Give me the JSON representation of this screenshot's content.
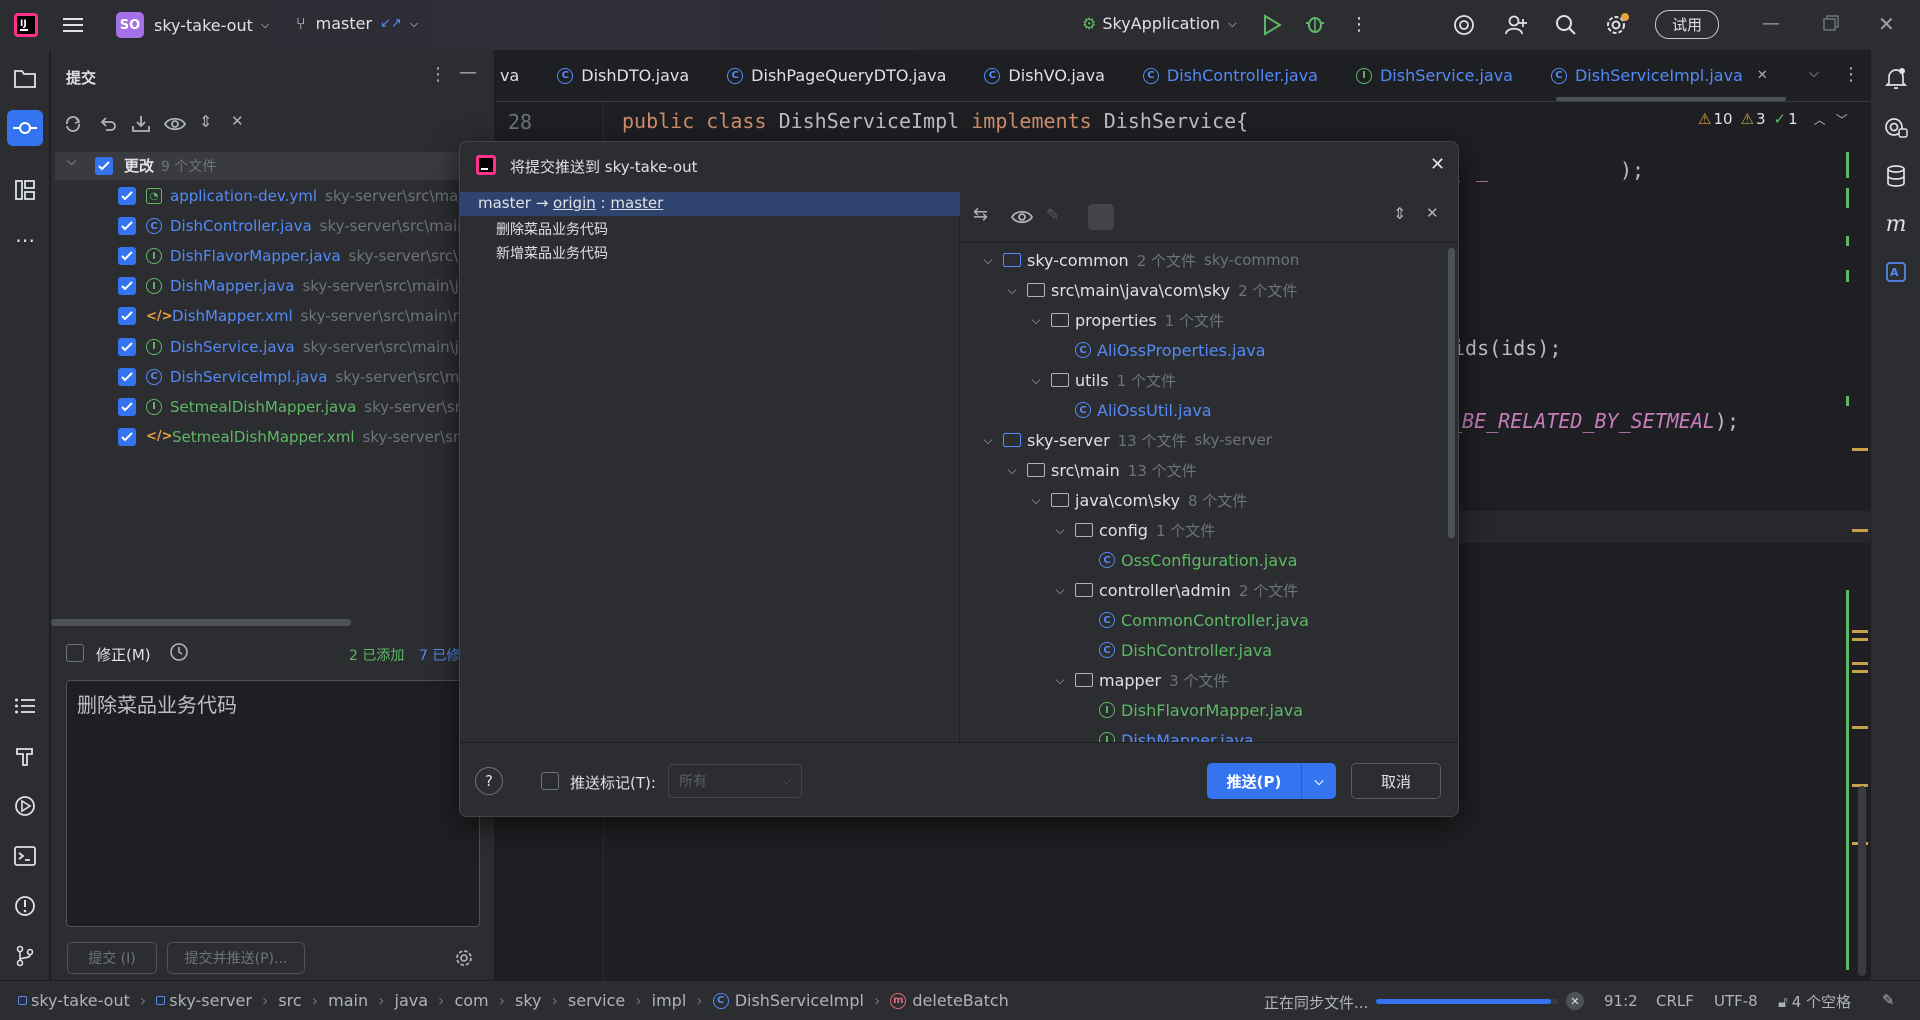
{
  "titlebar": {
    "project_badge": "SO",
    "project_name": "sky-take-out",
    "branch": "master",
    "run_config": "SkyApplication",
    "trial_label": "试用"
  },
  "commit_panel": {
    "title": "提交",
    "changes_label": "更改",
    "changes_count": "9 个文件",
    "files": [
      {
        "name": "application-dev.yml",
        "path": "sky-server\\src\\main",
        "kind": "yml",
        "color": "blue"
      },
      {
        "name": "DishController.java",
        "path": "sky-server\\src\\main\\",
        "kind": "class",
        "color": "blue"
      },
      {
        "name": "DishFlavorMapper.java",
        "path": "sky-server\\src\\m",
        "kind": "interface",
        "color": "blue"
      },
      {
        "name": "DishMapper.java",
        "path": "sky-server\\src\\main\\ja",
        "kind": "interface",
        "color": "blue"
      },
      {
        "name": "DishMapper.xml",
        "path": "sky-server\\src\\main\\re",
        "kind": "xml",
        "color": "blue"
      },
      {
        "name": "DishService.java",
        "path": "sky-server\\src\\main\\jav",
        "kind": "interface",
        "color": "blue"
      },
      {
        "name": "DishServiceImpl.java",
        "path": "sky-server\\src\\mai",
        "kind": "class",
        "color": "blue"
      },
      {
        "name": "SetmealDishMapper.java",
        "path": "sky-server\\src\\",
        "kind": "interface",
        "color": "green"
      },
      {
        "name": "SetmealDishMapper.xml",
        "path": "sky-server\\src\\",
        "kind": "xml",
        "color": "green"
      }
    ],
    "amend_label": "修正(M)",
    "added_text": "2 已添加",
    "modified_text": "7 已修",
    "message": "删除菜品业务代码",
    "commit_button": "提交 (I)",
    "commit_push_button": "提交并推送(P)..."
  },
  "editor": {
    "tabs": [
      {
        "label": "va",
        "icon": "none",
        "color": "normal"
      },
      {
        "label": "DishDTO.java",
        "icon": "class",
        "color": "normal"
      },
      {
        "label": "DishPageQueryDTO.java",
        "icon": "class",
        "color": "normal"
      },
      {
        "label": "DishVO.java",
        "icon": "class",
        "color": "normal"
      },
      {
        "label": "DishController.java",
        "icon": "class",
        "color": "blue"
      },
      {
        "label": "DishService.java",
        "icon": "interface",
        "color": "blue"
      },
      {
        "label": "DishServiceImpl.java",
        "icon": "class",
        "color": "blue"
      }
    ],
    "line_number": "28",
    "code_line": {
      "kw1": "public",
      "kw2": "class",
      "name": "DishServiceImpl",
      "kw3": "implements",
      "iface": "DishService{"
    },
    "fragment_ids": "ids(ids);",
    "fragment_const": "_BE_RELATED_BY_SETMEAL",
    "fragment_const_tail": ");",
    "warnings": "10",
    "weak_warnings": "3",
    "checks": "1"
  },
  "dialog": {
    "title": "将提交推送到 sky-take-out",
    "push_target": {
      "local": "master",
      "arrow": "→",
      "remote": "origin",
      "sep": ":",
      "branch": "master"
    },
    "commits": [
      "删除菜品业务代码",
      "新增菜品业务代码"
    ],
    "tree": [
      {
        "level": 0,
        "type": "module",
        "label": "sky-common",
        "count": "2 个文件",
        "extra": "sky-common"
      },
      {
        "level": 1,
        "type": "folder",
        "label": "src\\main\\java\\com\\sky",
        "count": "2 个文件"
      },
      {
        "level": 2,
        "type": "folder",
        "label": "properties",
        "count": "1 个文件"
      },
      {
        "level": 3,
        "type": "class",
        "label": "AliOssProperties.java",
        "color": "blue"
      },
      {
        "level": 2,
        "type": "folder",
        "label": "utils",
        "count": "1 个文件"
      },
      {
        "level": 3,
        "type": "class",
        "label": "AliOssUtil.java",
        "color": "blue"
      },
      {
        "level": 0,
        "type": "module",
        "label": "sky-server",
        "count": "13 个文件",
        "extra": "sky-server"
      },
      {
        "level": 1,
        "type": "folder",
        "label": "src\\main",
        "count": "13 个文件"
      },
      {
        "level": 2,
        "type": "folder",
        "label": "java\\com\\sky",
        "count": "8 个文件"
      },
      {
        "level": 3,
        "type": "folder",
        "label": "config",
        "count": "1 个文件"
      },
      {
        "level": 4,
        "type": "class",
        "label": "OssConfiguration.java",
        "color": "green"
      },
      {
        "level": 3,
        "type": "folder",
        "label": "controller\\admin",
        "count": "2 个文件"
      },
      {
        "level": 4,
        "type": "class",
        "label": "CommonController.java",
        "color": "green"
      },
      {
        "level": 4,
        "type": "class",
        "label": "DishController.java",
        "color": "green"
      },
      {
        "level": 3,
        "type": "folder",
        "label": "mapper",
        "count": "3 个文件"
      },
      {
        "level": 4,
        "type": "interface",
        "label": "DishFlavorMapper.java",
        "color": "green"
      },
      {
        "level": 4,
        "type": "interface",
        "label": "DishMapper.java",
        "color": "blue"
      }
    ],
    "push_tags_label": "推送标记(T):",
    "push_tags_value": "所有",
    "push_button": "推送(P)",
    "cancel_button": "取消",
    "help": "?"
  },
  "statusbar": {
    "crumbs": [
      "sky-take-out",
      "sky-server",
      "src",
      "main",
      "java",
      "com",
      "sky",
      "service",
      "impl",
      "DishServiceImpl",
      "deleteBatch"
    ],
    "sync_text": "正在同步文件...",
    "sync_progress": 0.96,
    "position": "91:2",
    "line_sep": "CRLF",
    "encoding": "UTF-8",
    "indent": "4 个空格"
  },
  "colors": {
    "accent": "#3574f0",
    "blue_file": "#548af7",
    "green_file": "#5fb865",
    "keyword": "#cf8e6d",
    "const": "#c77dbb"
  }
}
